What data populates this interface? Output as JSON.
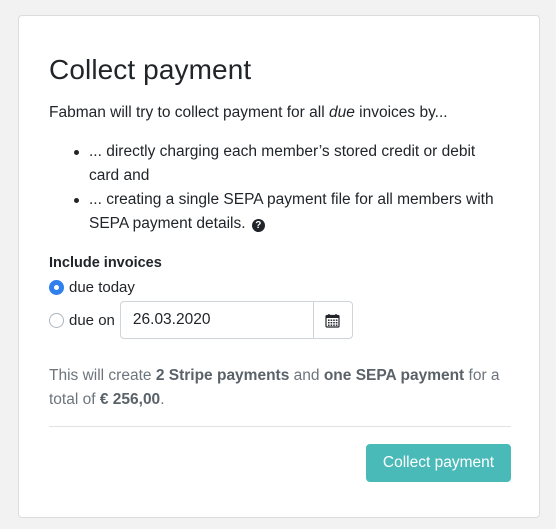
{
  "card": {
    "title": "Collect payment",
    "intro": {
      "prefix": "Fabman will try to collect payment for all ",
      "emphasis": "due",
      "suffix": " invoices by..."
    },
    "bullets": [
      {
        "text": "... directly charging each member’s stored credit or debit card and"
      },
      {
        "text": "... creating a single SEPA payment file for all members with SEPA payment details.",
        "help_icon": "question-circle-icon"
      }
    ],
    "help_glyph": "?",
    "include_invoices": {
      "label": "Include invoices",
      "options": [
        {
          "label": "due today",
          "selected": true
        },
        {
          "label": "due on",
          "selected": false
        }
      ],
      "date_value": "26.03.2020",
      "calendar_icon": "calendar-icon"
    },
    "summary": {
      "part1": "This will create ",
      "stripe": "2 Stripe payments",
      "part2": " and ",
      "sepa": "one SEPA payment",
      "part3": " for a total of ",
      "total": "€ 256,00",
      "part4": "."
    },
    "submit_label": "Collect payment"
  },
  "colors": {
    "accent_button": "#49bab8",
    "radio_selected": "#2f80ed",
    "muted_text": "#6c757d",
    "background": "#f2f2f2"
  }
}
